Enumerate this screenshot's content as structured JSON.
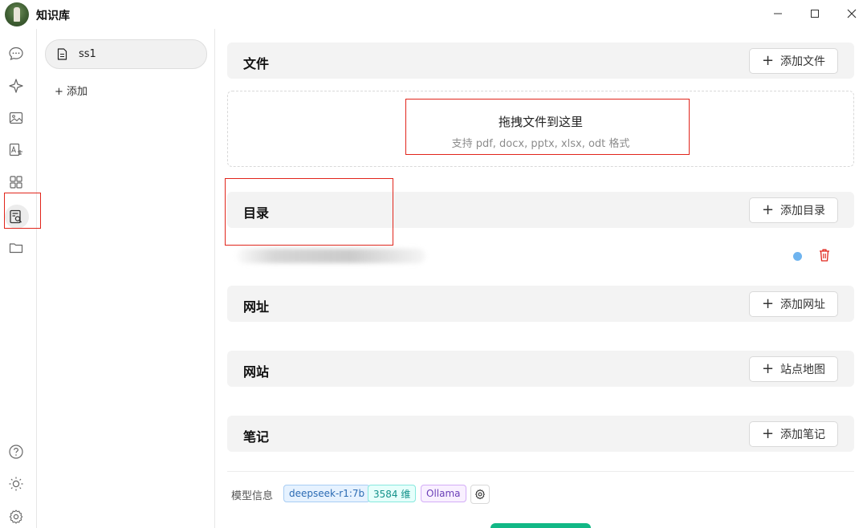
{
  "app": {
    "title": "知识库"
  },
  "window_controls": {
    "minimize": "—",
    "maximize": "☐",
    "close": "✕"
  },
  "rail": {
    "items": [
      {
        "icon": "chat-icon"
      },
      {
        "icon": "sparkle-icon"
      },
      {
        "icon": "image-icon"
      },
      {
        "icon": "translate-image-icon"
      },
      {
        "icon": "apps-grid-icon"
      },
      {
        "icon": "knowledge-search-icon",
        "active": true
      },
      {
        "icon": "folder-icon"
      }
    ],
    "bottom": [
      {
        "icon": "help-icon"
      },
      {
        "icon": "theme-sun-icon"
      },
      {
        "icon": "settings-gear-icon"
      }
    ]
  },
  "knowledge_bases": {
    "items": [
      {
        "label": "ss1",
        "icon": "document-icon"
      }
    ],
    "add_label": "+ 添加"
  },
  "sections": {
    "files": {
      "title": "文件",
      "button": "添加文件"
    },
    "dropzone": {
      "title": "拖拽文件到这里",
      "subtitle": "支持 pdf, docx, pptx, xlsx, odt 格式"
    },
    "directory": {
      "title": "目录",
      "button": "添加目录"
    },
    "url": {
      "title": "网址",
      "button": "添加网址"
    },
    "website": {
      "title": "网站",
      "button": "站点地图"
    },
    "notes": {
      "title": "笔记",
      "button": "添加笔记"
    }
  },
  "model_info": {
    "label": "模型信息",
    "model": "deepseek-r1:7b",
    "dims": "3584 维",
    "provider": "Ollama"
  },
  "colors": {
    "accent_red": "#e1251b",
    "status_dot": "#6fb4ef",
    "primary_green": "#12b886"
  }
}
